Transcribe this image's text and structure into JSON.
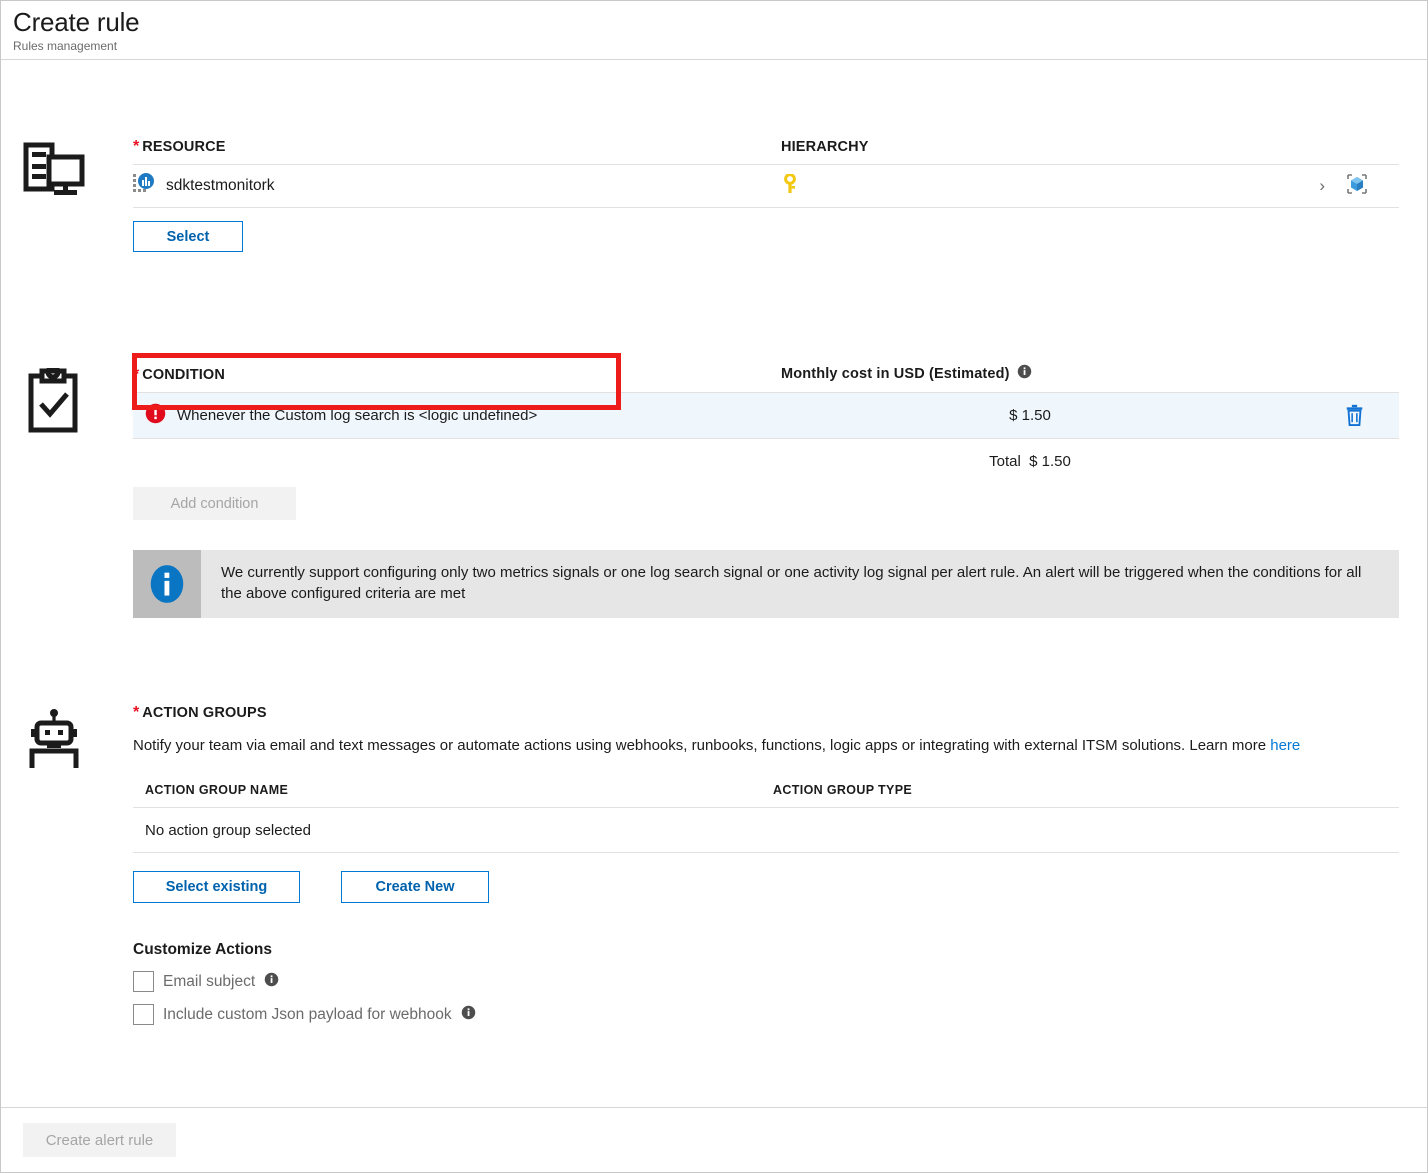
{
  "header": {
    "title": "Create rule",
    "subtitle": "Rules management"
  },
  "resource": {
    "icon": "monitor-device-icon",
    "label": "RESOURCE",
    "required": true,
    "hierarchy_label": "HIERARCHY",
    "row": {
      "resource_icon": "application-insights-icon",
      "name": "sdktestmonitork",
      "hierarchy": {
        "subscription_icon": "key-icon",
        "chevron_icon": "chevron-right-icon",
        "resource_group_icon": "resource-group-cube-icon"
      }
    },
    "select_button": "Select"
  },
  "condition": {
    "icon": "clipboard-check-icon",
    "label": "CONDITION",
    "required": true,
    "cost_header": "Monthly cost in USD (Estimated)",
    "cost_header_info_icon": "info-icon",
    "rows": [
      {
        "status_icon": "error-icon",
        "description": "Whenever the Custom log search is <logic undefined>",
        "cost": "$ 1.50",
        "delete_icon": "trash-icon"
      }
    ],
    "total_label": "Total",
    "total_cost": "$ 1.50",
    "add_condition_button": "Add condition",
    "add_condition_disabled": true,
    "banner": {
      "icon": "info-icon",
      "text": "We currently support configuring only two metrics signals or one log search signal or one activity log signal per alert rule. An alert will be triggered when the conditions for all the above configured criteria are met"
    }
  },
  "action_groups": {
    "icon": "robot-icon",
    "label": "ACTION GROUPS",
    "required": true,
    "description": "Notify your team via email and text messages or automate actions using webhooks, runbooks, functions, logic apps or integrating with external ITSM solutions. Learn more ",
    "learn_more_link": "here",
    "table": {
      "columns": [
        "ACTION GROUP NAME",
        "ACTION GROUP TYPE"
      ],
      "empty_text": "No action group selected"
    },
    "select_existing_button": "Select existing",
    "create_new_button": "Create New",
    "customize_title": "Customize Actions",
    "checkboxes": [
      {
        "label": "Email subject",
        "checked": false,
        "info_icon": "info-icon"
      },
      {
        "label": "Include custom Json payload for webhook",
        "checked": false,
        "info_icon": "info-icon"
      }
    ]
  },
  "footer": {
    "create_button": "Create alert rule",
    "create_button_disabled": true
  },
  "annotation": {
    "type": "red-highlight-box",
    "color": "#ee1b1b",
    "target": "condition-row-0"
  },
  "colors": {
    "accent_blue": "#0078d4",
    "link_blue": "#0078d4",
    "required_red": "#e81123",
    "error_red": "#e00b1c",
    "row_highlight": "#eff6fc",
    "annotation_red": "#ee1b1b",
    "disabled_grey": "#a5a5a5",
    "banner_grey": "#e6e6e6"
  }
}
